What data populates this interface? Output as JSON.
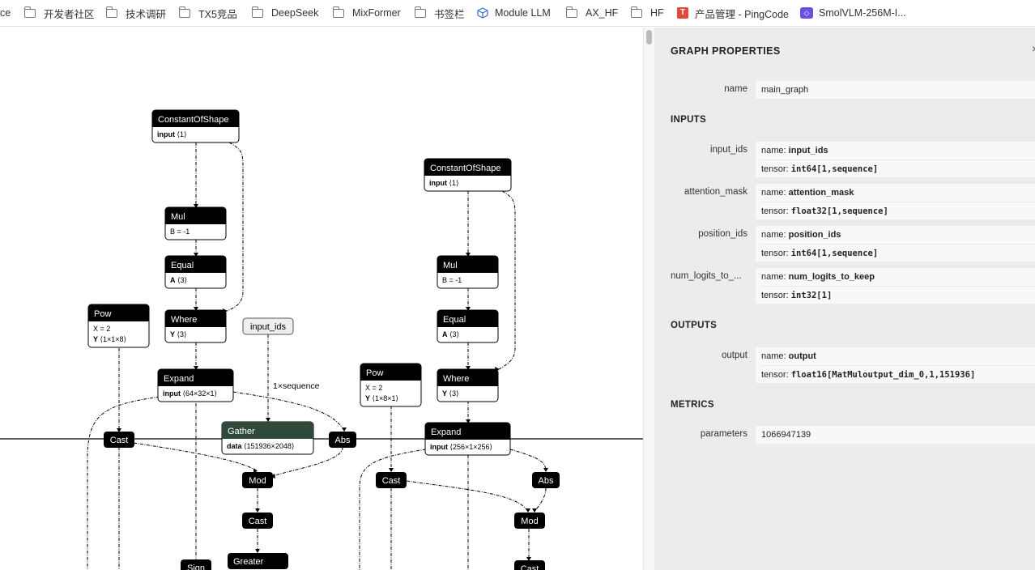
{
  "bookmarks": [
    {
      "label": "ce",
      "icon": "none"
    },
    {
      "label": "开发者社区",
      "icon": "folder-icon"
    },
    {
      "label": "技术调研",
      "icon": "folder-icon"
    },
    {
      "label": "TX5竞品",
      "icon": "folder-icon"
    },
    {
      "label": "DeepSeek",
      "icon": "folder-icon"
    },
    {
      "label": "MixFormer",
      "icon": "folder-icon"
    },
    {
      "label": "书签栏",
      "icon": "folder-icon"
    },
    {
      "label": "Module LLM",
      "icon": "cube-icon"
    },
    {
      "label": "AX_HF",
      "icon": "folder-icon"
    },
    {
      "label": "HF",
      "icon": "folder-icon"
    },
    {
      "label": "产品管理 - PingCode",
      "icon": "pingcode-icon"
    },
    {
      "label": "SmolVLM-256M-I...",
      "icon": "smolvlm-icon"
    }
  ],
  "graph": {
    "nodes": {
      "cos1": {
        "title": "ConstantOfShape",
        "attrs": [
          {
            "k": "input",
            "v": "⟨1⟩",
            "bold": true
          }
        ]
      },
      "mul1": {
        "title": "Mul",
        "attrs": [
          {
            "k": "B",
            "v": "= -1",
            "bold": false
          }
        ]
      },
      "eq1": {
        "title": "Equal",
        "attrs": [
          {
            "k": "A",
            "v": "⟨3⟩",
            "bold": true
          }
        ]
      },
      "pow1": {
        "title": "Pow",
        "attrs": [
          {
            "k": "X",
            "v": "= 2",
            "bold": false
          },
          {
            "k": "Y",
            "v": "⟨1×1×8⟩",
            "bold": true
          }
        ]
      },
      "where1": {
        "title": "Where",
        "attrs": [
          {
            "k": "Y",
            "v": "⟨3⟩",
            "bold": true
          }
        ]
      },
      "expand1": {
        "title": "Expand",
        "attrs": [
          {
            "k": "input",
            "v": "⟨64×32×1⟩",
            "bold": true
          }
        ]
      },
      "gather": {
        "title": "Gather",
        "attrs": [
          {
            "k": "data",
            "v": "⟨151936×2048⟩",
            "bold": true
          }
        ]
      },
      "cos2": {
        "title": "ConstantOfShape",
        "attrs": [
          {
            "k": "input",
            "v": "⟨1⟩",
            "bold": true
          }
        ]
      },
      "mul2": {
        "title": "Mul",
        "attrs": [
          {
            "k": "B",
            "v": "= -1",
            "bold": false
          }
        ]
      },
      "eq2": {
        "title": "Equal",
        "attrs": [
          {
            "k": "A",
            "v": "⟨3⟩",
            "bold": true
          }
        ]
      },
      "where2": {
        "title": "Where",
        "attrs": [
          {
            "k": "Y",
            "v": "⟨3⟩",
            "bold": true
          }
        ]
      },
      "pow2": {
        "title": "Pow",
        "attrs": [
          {
            "k": "X",
            "v": "= 2",
            "bold": false
          },
          {
            "k": "Y",
            "v": "⟨1×8×1⟩",
            "bold": true
          }
        ]
      },
      "expand2": {
        "title": "Expand",
        "attrs": [
          {
            "k": "input",
            "v": "⟨256×1×256⟩",
            "bold": true
          }
        ]
      }
    },
    "ops": {
      "cast1": "Cast",
      "abs1": "Abs",
      "mod1": "Mod",
      "cast2": "Cast",
      "greater": "Greater",
      "sign": "Sign",
      "cast3": "Cast",
      "abs2": "Abs",
      "mod2": "Mod",
      "cast4": "Cast"
    },
    "input_node": "input_ids",
    "edge_label": "1×sequence"
  },
  "sidebar": {
    "title": "GRAPH PROPERTIES",
    "close": "×",
    "name_label": "name",
    "name_value": "main_graph",
    "inputs_title": "INPUTS",
    "inputs": [
      {
        "label": "input_ids",
        "name": "input_ids",
        "tensor": "int64[1,sequence]"
      },
      {
        "label": "attention_mask",
        "name": "attention_mask",
        "tensor": "float32[1,sequence]"
      },
      {
        "label": "position_ids",
        "name": "position_ids",
        "tensor": "int64[1,sequence]"
      },
      {
        "label": "num_logits_to_...",
        "name": "num_logits_to_keep",
        "tensor": "int32[1]"
      }
    ],
    "outputs_title": "OUTPUTS",
    "outputs": [
      {
        "label": "output",
        "name": "output",
        "tensor": "float16[MatMuloutput_dim_0,1,151936]"
      }
    ],
    "metrics_title": "METRICS",
    "metrics": [
      {
        "label": "parameters",
        "value": "1066947139"
      }
    ],
    "name_prefix": "name: ",
    "tensor_prefix": "tensor: "
  }
}
